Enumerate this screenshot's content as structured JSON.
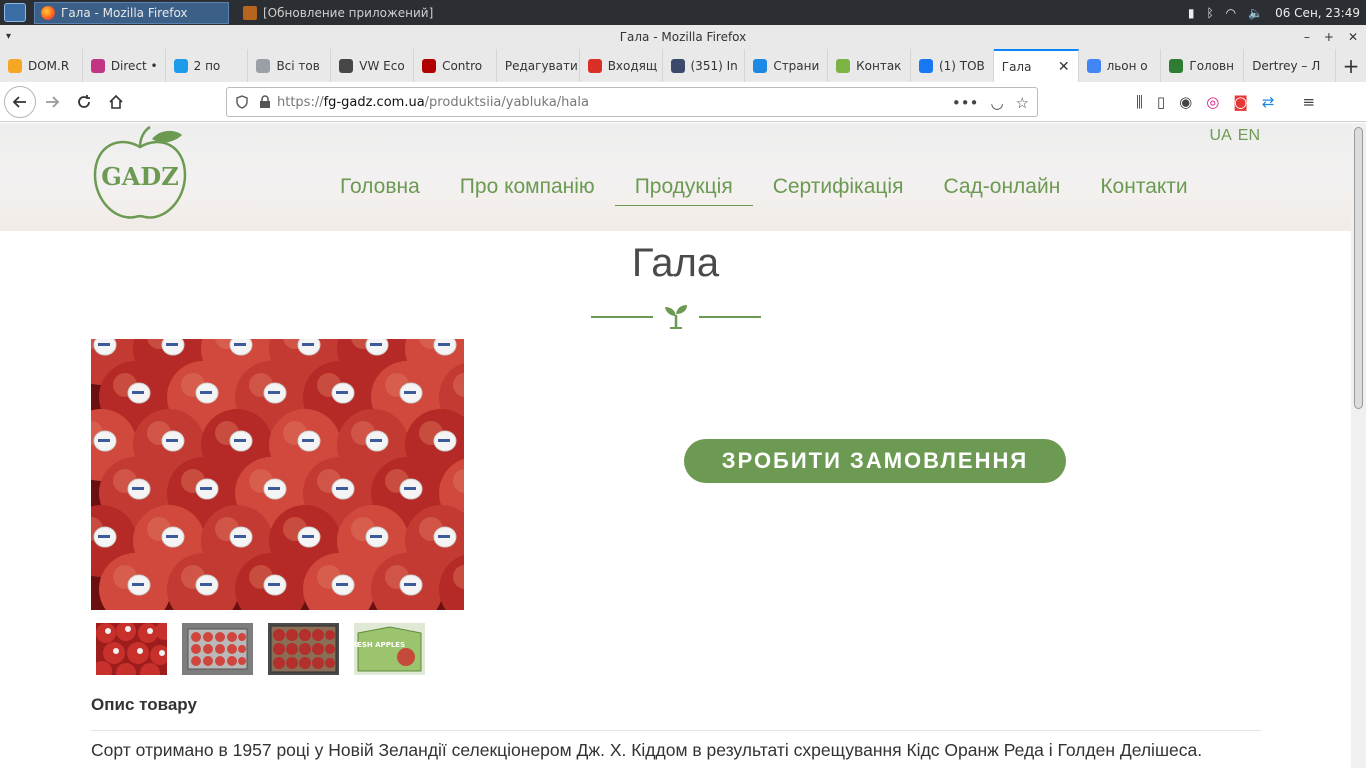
{
  "taskbar": {
    "tasks": [
      {
        "label": "Гала - Mozilla Firefox",
        "active": true
      },
      {
        "label": "[Обновление приложений]",
        "active": false
      }
    ],
    "clock": "06 Сен, 23:49"
  },
  "window": {
    "title": "Гала - Mozilla Firefox"
  },
  "tabs": [
    {
      "label": "DOM.R",
      "color": "#f5a623"
    },
    {
      "label": "Direct •",
      "color": "#c13584"
    },
    {
      "label": "2 по",
      "color": "#1e9be9"
    },
    {
      "label": "Всі тов",
      "color": "#9aa0a6"
    },
    {
      "label": "VW Eco",
      "color": "#464646"
    },
    {
      "label": "Contro",
      "color": "#b00000"
    },
    {
      "label": "Редагувати",
      "color": ""
    },
    {
      "label": "Входящ",
      "color": "#d93025"
    },
    {
      "label": "(351) In",
      "color": "#3b4a6b"
    },
    {
      "label": "Страни",
      "color": "#1e88e5"
    },
    {
      "label": "Контак",
      "color": "#7cb342"
    },
    {
      "label": "(1) TOB",
      "color": "#1877f2"
    },
    {
      "label": "Гала",
      "color": "",
      "active": true
    },
    {
      "label": "льон о",
      "color": "#4285f4"
    },
    {
      "label": "Головн",
      "color": "#2e7d32"
    },
    {
      "label": "Dertrey – Л",
      "color": ""
    }
  ],
  "urlbar": {
    "prefix": "https://",
    "domain": "fg-gadz.com.ua",
    "path": "/produktsiia/yabluka/hala"
  },
  "site": {
    "logo_text": "GADZ",
    "lang": [
      "UA",
      "EN"
    ],
    "menu": [
      "Головна",
      "Про компанію",
      "Продукція",
      "Сертифікація",
      "Сад-онлайн",
      "Контакти"
    ],
    "active_menu_index": 2,
    "accent": "#6c9a52"
  },
  "product": {
    "title": "Гала",
    "order_button": "ЗРОБИТИ ЗАМОВЛЕННЯ",
    "thumb4_text": "FRESH APPLES",
    "description_heading": "Опис товару",
    "description_text": "Сорт отримано в 1957 році у Новій Зеландії селекціонером Дж. Х. Кіддом в результаті схрещування Кідс Оранж Реда і Голден Делішеса."
  }
}
